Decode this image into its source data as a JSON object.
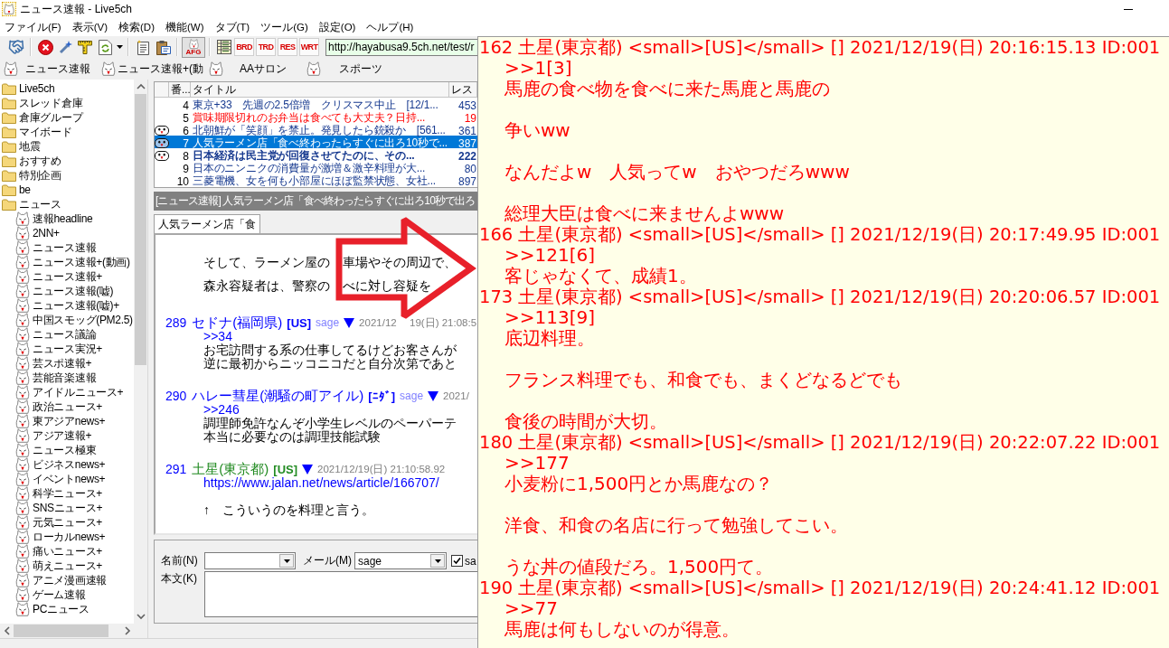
{
  "window": {
    "title": "ニュース速報 - Live5ch"
  },
  "menu": [
    "ファイル(F)",
    "表示(V)",
    "検索(D)",
    "機能(W)",
    "タブ(T)",
    "ツール(G)",
    "設定(O)",
    "ヘルプ(H)"
  ],
  "toolbar": {
    "filter_button": {
      "label": "AFG",
      "pressed": true
    },
    "view_buttons": [
      {
        "label": "BRD"
      },
      {
        "label": "TRD"
      },
      {
        "label": "RES"
      },
      {
        "label": "WRT"
      }
    ],
    "address": "http://hayabusa9.5ch.net/test/r"
  },
  "board_tabs": [
    {
      "label": "ニュース速報"
    },
    {
      "label": "ニュース速報+(動"
    },
    {
      "label": "AAサロン"
    },
    {
      "label": "スポーツ"
    }
  ],
  "sidebar": {
    "items": [
      {
        "label": "Live5ch",
        "kind": "folder"
      },
      {
        "label": "スレッド倉庫",
        "kind": "folder"
      },
      {
        "label": "倉庫グループ",
        "kind": "folder"
      },
      {
        "label": "マイボード",
        "kind": "folder"
      },
      {
        "label": "地震",
        "kind": "folder"
      },
      {
        "label": "おすすめ",
        "kind": "folder"
      },
      {
        "label": "特別企画",
        "kind": "folder"
      },
      {
        "label": "be",
        "kind": "folder"
      },
      {
        "label": "ニュース",
        "kind": "folder",
        "children": [
          {
            "label": "速報headline",
            "kind": "board"
          },
          {
            "label": "2NN+",
            "kind": "board"
          },
          {
            "label": "ニュース速報",
            "kind": "board"
          },
          {
            "label": "ニュース速報+(動画)",
            "kind": "board"
          },
          {
            "label": "ニュース速報+",
            "kind": "board"
          },
          {
            "label": "ニュース速報(嘘)",
            "kind": "board"
          },
          {
            "label": "ニュース速報(嘘)+",
            "kind": "board"
          },
          {
            "label": "中国スモッグ(PM2.5)",
            "kind": "board"
          },
          {
            "label": "ニュース議論",
            "kind": "board"
          },
          {
            "label": "ニュース実況+",
            "kind": "board"
          },
          {
            "label": "芸スポ速報+",
            "kind": "board"
          },
          {
            "label": "芸能音楽速報",
            "kind": "board"
          },
          {
            "label": "アイドルニュース+",
            "kind": "board"
          },
          {
            "label": "政治ニュース+",
            "kind": "board"
          },
          {
            "label": "東アジアnews+",
            "kind": "board"
          },
          {
            "label": "アジア速報+",
            "kind": "board"
          },
          {
            "label": "ニュース極東",
            "kind": "board"
          },
          {
            "label": "ビジネスnews+",
            "kind": "board"
          },
          {
            "label": "イベントnews+",
            "kind": "board"
          },
          {
            "label": "科学ニュース+",
            "kind": "board"
          },
          {
            "label": "SNSニュース+",
            "kind": "board"
          },
          {
            "label": "元気ニュース+",
            "kind": "board"
          },
          {
            "label": "ローカルnews+",
            "kind": "board"
          },
          {
            "label": "痛いニュース+",
            "kind": "board"
          },
          {
            "label": "萌えニュース+",
            "kind": "board"
          },
          {
            "label": "アニメ漫画速報",
            "kind": "board"
          },
          {
            "label": "ゲーム速報",
            "kind": "board"
          },
          {
            "label": "PCニュース",
            "kind": "board"
          }
        ]
      }
    ]
  },
  "thread_list": {
    "columns": [
      "番...",
      "タイトル",
      "レス"
    ],
    "rows": [
      {
        "number": "4",
        "title": "東京+33　先週の2.5倍増　クリスマス中止　[12/1...",
        "count": "453",
        "highlighted": false,
        "bold": false,
        "has_log": false,
        "selected": false
      },
      {
        "number": "5",
        "title": "賞味期限切れのお弁当は食べても大丈夫？日持...",
        "count": "19",
        "highlighted": true,
        "bold": false,
        "has_log": false,
        "selected": false
      },
      {
        "number": "6",
        "title": "北朝鮮が「笑顔」を禁止。発見したら銃殺か　[561...",
        "count": "361",
        "highlighted": false,
        "bold": false,
        "has_log": true,
        "selected": false
      },
      {
        "number": "7",
        "title": "人気ラーメン店「食べ終わったらすぐに出ろ10秒で...",
        "count": "387",
        "highlighted": false,
        "bold": false,
        "has_log": true,
        "selected": true
      },
      {
        "number": "8",
        "title": "日本経済は民主党が回復させてたのに、その...",
        "count": "222",
        "highlighted": false,
        "bold": true,
        "has_log": true,
        "selected": false
      },
      {
        "number": "9",
        "title": "日本のニンニクの消費量が激増＆激辛料理が大...",
        "count": "80",
        "highlighted": false,
        "bold": false,
        "has_log": false,
        "selected": false
      },
      {
        "number": "10",
        "title": "三菱電機、女を何も小部屋にほぼ監禁状態、女社...",
        "count": "897",
        "highlighted": false,
        "bold": false,
        "has_log": false,
        "selected": false
      }
    ]
  },
  "thread_title": "[ニュース速報] 人気ラーメン店「食べ終わったらすぐに出ろ10秒で出ろ",
  "thread_tabs": [
    {
      "label": "人気ラーメン店「食",
      "selected": true
    }
  ],
  "post_view": {
    "previous_post_lines": [
      [
        "そして、ラーメン屋の",
        "車場やその周辺で、"
      ],
      [
        "森永容疑者は、警察の",
        "べに対し容疑を"
      ]
    ],
    "posts": [
      {
        "number": "289",
        "name": "セドナ(福岡県)",
        "color": "#0000ff",
        "tag": "[US]",
        "mail": "sage",
        "date_parts": [
          "2021/12",
          "19(日) 21:08:5"
        ],
        "paragraphs": [
          [
            {
              "kind": "anchor",
              "text": ">>34"
            },
            {
              "kind": "text",
              "text": "お宅訪問する系の仕事してるけどお客さんが"
            },
            {
              "kind": "text",
              "text": "逆に最初からニッコニコだと自分次第であと"
            }
          ]
        ]
      },
      {
        "number": "290",
        "name": "ハレー彗星(潮騒の町アイル)",
        "color": "#0000ff",
        "tag": "[ﾆﾀﾞ]",
        "mail": "sage",
        "date_parts": [
          "2021/"
        ],
        "paragraphs": [
          [
            {
              "kind": "anchor",
              "text": ">>246"
            },
            {
              "kind": "text",
              "text": "調理師免許なんぞ小学生レベルのペーパーテ"
            },
            {
              "kind": "text",
              "text": "本当に必要なのは調理技能試験"
            }
          ]
        ]
      },
      {
        "number": "291",
        "name": "土星(東京都)",
        "color": "#228b22",
        "tag": "[US]",
        "date_parts": [
          "2021/12/19(日) 21:10:58.92"
        ],
        "paragraphs": [
          [
            {
              "kind": "link",
              "text": "https://www.jalan.net/news/article/166707/"
            }
          ],
          [
            {
              "kind": "text",
              "text": "↑　こういうのを料理と言う。"
            }
          ]
        ]
      }
    ]
  },
  "form": {
    "name_label": "名前(N)",
    "mail_label": "メール(M)",
    "mail_value": "sage",
    "sage_checkbox": {
      "label": "sa",
      "checked": true
    },
    "body_label": "本文(K)"
  },
  "popup": {
    "posts": [
      {
        "header": "162 土星(東京都) <small>[US]</small> [] 2021/12/19(日) 20:16:15.13 ID:001",
        "paragraphs": [
          [
            ">>1[3]",
            "馬鹿の食べ物を食べに来た馬鹿と馬鹿の"
          ],
          [
            "争いww"
          ],
          [
            "なんだよw　人気ってw　おやつだろwww"
          ],
          [
            "総理大臣は食べに来ませんよwww"
          ]
        ]
      },
      {
        "header": "166 土星(東京都) <small>[US]</small> [] 2021/12/19(日) 20:17:49.95 ID:001",
        "paragraphs": [
          [
            ">>121[6]",
            "客じゃなくて、成績1。"
          ]
        ]
      },
      {
        "header": "173 土星(東京都) <small>[US]</small> [] 2021/12/19(日) 20:20:06.57 ID:001",
        "paragraphs": [
          [
            ">>113[9]",
            "底辺料理。"
          ],
          [
            "フランス料理でも、和食でも、まくどなるどでも"
          ],
          [
            "食後の時間が大切。"
          ]
        ]
      },
      {
        "header": "180 土星(東京都) <small>[US]</small> [] 2021/12/19(日) 20:22:07.22 ID:001",
        "paragraphs": [
          [
            ">>177",
            "小麦粉に1,500円とか馬鹿なの？"
          ],
          [
            "洋食、和食の名店に行って勉強してこい。"
          ],
          [
            "うな丼の値段だろ。1,500円て。"
          ]
        ]
      },
      {
        "header": "190 土星(東京都) <small>[US]</small> [] 2021/12/19(日) 20:24:41.12 ID:001",
        "paragraphs": [
          [
            ">>77",
            "馬鹿は何もしないのが得意。"
          ]
        ]
      }
    ]
  }
}
